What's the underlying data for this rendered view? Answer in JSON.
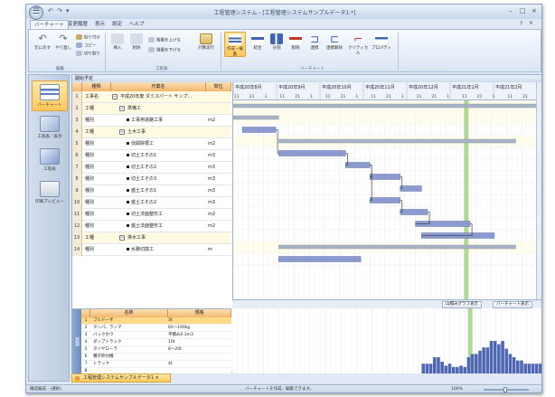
{
  "window": {
    "title": "工程管理システム - [工程管理システムサンプルデータ1.*]",
    "min_glyph": "–",
    "max_glyph": "□",
    "close_glyph": "×"
  },
  "menu_tabs": [
    "バーチャート",
    "変更履歴",
    "表示",
    "設定",
    "ヘルプ"
  ],
  "ribbon": {
    "clipboard": {
      "undo": "元に戻す",
      "redo": "やり直し",
      "paste": "貼り付け",
      "copy": "コピー",
      "cut": "切り取り",
      "group": "編集"
    },
    "process": {
      "insert": "挿入",
      "delete": "削除",
      "level_up": "階層を上げる",
      "level_down": "階層を下げる",
      "calc": "計算実行",
      "group": "工程表"
    },
    "chart": {
      "items": [
        "作成・編集",
        "結合",
        "分割",
        "削除",
        "連携",
        "連携解除",
        "クリティカル",
        "プロパティ"
      ],
      "group": "バーチャート"
    }
  },
  "nav": [
    "バーチャート",
    "工程表／表示",
    "工程表",
    "印刷プレビュー"
  ],
  "panel_title": "開始予定",
  "grid": {
    "headers": [
      "種類",
      "作業名",
      "単位"
    ],
    "rows": [
      {
        "n": "1",
        "kind": "工事名",
        "name": "平成20年度 ダミスパート サンプ...",
        "unit": "",
        "level": 0,
        "toggle": "−"
      },
      {
        "n": "2",
        "kind": "工種",
        "name": "準備工",
        "unit": "",
        "level": 1,
        "toggle": "−"
      },
      {
        "n": "3",
        "kind": "種別",
        "name": "工事用道路工事",
        "unit": "m2",
        "level": 2,
        "toggle": ""
      },
      {
        "n": "4",
        "kind": "工種",
        "name": "土木工事",
        "unit": "",
        "level": 1,
        "toggle": "−"
      },
      {
        "n": "5",
        "kind": "種別",
        "name": "伐開除根工",
        "unit": "m2",
        "level": 2,
        "toggle": ""
      },
      {
        "n": "6",
        "kind": "種別",
        "name": "切土工その1",
        "unit": "m3",
        "level": 2,
        "toggle": ""
      },
      {
        "n": "7",
        "kind": "種別",
        "name": "切土工その2",
        "unit": "m3",
        "level": 2,
        "toggle": ""
      },
      {
        "n": "8",
        "kind": "種別",
        "name": "切土工その3",
        "unit": "m3",
        "level": 2,
        "toggle": ""
      },
      {
        "n": "9",
        "kind": "種別",
        "name": "盛土工その1",
        "unit": "m3",
        "level": 2,
        "toggle": ""
      },
      {
        "n": "10",
        "kind": "種別",
        "name": "盛土工その2",
        "unit": "m3",
        "level": 2,
        "toggle": ""
      },
      {
        "n": "11",
        "kind": "種別",
        "name": "切土法面整形工",
        "unit": "m2",
        "level": 2,
        "toggle": ""
      },
      {
        "n": "12",
        "kind": "種別",
        "name": "盛土法面整形工",
        "unit": "m2",
        "level": 2,
        "toggle": ""
      },
      {
        "n": "13",
        "kind": "工種",
        "name": "排水工事",
        "unit": "",
        "level": 1,
        "toggle": "−"
      },
      {
        "n": "14",
        "kind": "種別",
        "name": "水路切換工",
        "unit": "m",
        "level": 2,
        "toggle": ""
      }
    ]
  },
  "timeline": {
    "months": [
      "平成20年8月",
      "平成20年9月",
      "平成20年10月",
      "平成20年11月",
      "平成20年12月",
      "平成21年1月",
      "平成21年2月"
    ],
    "day_ticks": [
      "11",
      "21",
      "1",
      "11",
      "21",
      "1",
      "11",
      "21",
      "1",
      "11",
      "21",
      "1",
      "11",
      "21",
      "1",
      "11",
      "21",
      "1",
      "11",
      "21"
    ],
    "bars": [
      {
        "row": 1,
        "start": 0.0,
        "end": 1.0,
        "summary": true
      },
      {
        "row": 2,
        "start": 0.0,
        "end": 0.15,
        "summary": true
      },
      {
        "row": 3,
        "start": 0.03,
        "end": 0.14,
        "summary": false
      },
      {
        "row": 4,
        "start": 0.15,
        "end": 0.93,
        "summary": true
      },
      {
        "row": 5,
        "start": 0.15,
        "end": 0.37,
        "summary": false
      },
      {
        "row": 6,
        "start": 0.37,
        "end": 0.45,
        "summary": false
      },
      {
        "row": 7,
        "start": 0.45,
        "end": 0.55,
        "summary": false
      },
      {
        "row": 8,
        "start": 0.55,
        "end": 0.62,
        "summary": false
      },
      {
        "row": 9,
        "start": 0.45,
        "end": 0.55,
        "summary": false
      },
      {
        "row": 10,
        "start": 0.55,
        "end": 0.64,
        "summary": false
      },
      {
        "row": 11,
        "start": 0.6,
        "end": 0.78,
        "summary": false
      },
      {
        "row": 12,
        "start": 0.62,
        "end": 0.86,
        "summary": false
      },
      {
        "row": 13,
        "start": 0.15,
        "end": 0.93,
        "summary": true
      },
      {
        "row": 14,
        "start": 0.15,
        "end": 0.42,
        "summary": false
      }
    ],
    "links": [
      [
        3,
        5
      ],
      [
        5,
        6
      ],
      [
        6,
        7
      ],
      [
        7,
        8
      ],
      [
        6,
        9
      ],
      [
        9,
        10
      ],
      [
        10,
        11
      ],
      [
        11,
        12
      ]
    ],
    "today_line": 0.76,
    "colors": {
      "bar": "#8b9bd2",
      "summary": "#a8b4c6",
      "today": "#9ccf7a",
      "link": "#222222"
    }
  },
  "resource": {
    "side_label": "資源",
    "headers": [
      "名称",
      "規格"
    ],
    "rows": [
      {
        "n": "1",
        "name": "ブルドーザ",
        "spec": "3t",
        "sel": true
      },
      {
        "n": "2",
        "name": "タンパ、ランマ",
        "spec": "60～100kg",
        "sel": false
      },
      {
        "n": "3",
        "name": "バックホウ",
        "spec": "平積み0.3m3",
        "sel": false
      },
      {
        "n": "4",
        "name": "ダンプトラック",
        "spec": "10t",
        "sel": false
      },
      {
        "n": "5",
        "name": "タイヤローラ",
        "spec": "8～20t",
        "sel": false
      },
      {
        "n": "6",
        "name": "種子吹付機",
        "spec": "",
        "sel": false
      },
      {
        "n": "7",
        "name": "トラック",
        "spec": "4t",
        "sel": false
      },
      {
        "n": "8",
        "name": "",
        "spec": "",
        "sel": false
      }
    ]
  },
  "hist_buttons": {
    "left": "山積みグラフ表示",
    "right": "バーチャート表示"
  },
  "histogram": [
    0,
    0,
    0,
    0,
    0,
    0,
    0,
    0,
    0,
    0,
    0,
    0,
    0,
    0,
    0,
    0,
    0,
    0,
    0,
    0,
    0,
    0,
    0,
    0,
    0,
    0,
    0,
    0,
    0,
    0,
    0,
    0,
    0,
    0,
    0,
    0,
    0,
    0,
    0,
    0,
    0,
    0,
    0,
    0,
    0,
    0,
    0,
    0,
    0,
    0,
    0.15,
    0.15,
    0.15,
    0.25,
    0.25,
    0.18,
    0.12,
    0.15,
    0.1,
    0.1,
    0.12,
    0.1,
    0.25,
    0.3,
    0.3,
    0.35,
    0.4,
    0.4,
    0.5,
    0.5,
    0.45,
    0.5,
    0.38,
    0.3,
    0.25,
    0.2,
    0.2,
    0.15,
    0.15,
    0.15,
    0.15,
    0.15
  ],
  "doc_tab": "工程管理システムサンプルデータ1 ×",
  "status": {
    "left": "確認編成 - (選択)",
    "center": "バーチャートを作成／編集できます。",
    "zoom": "100%"
  }
}
